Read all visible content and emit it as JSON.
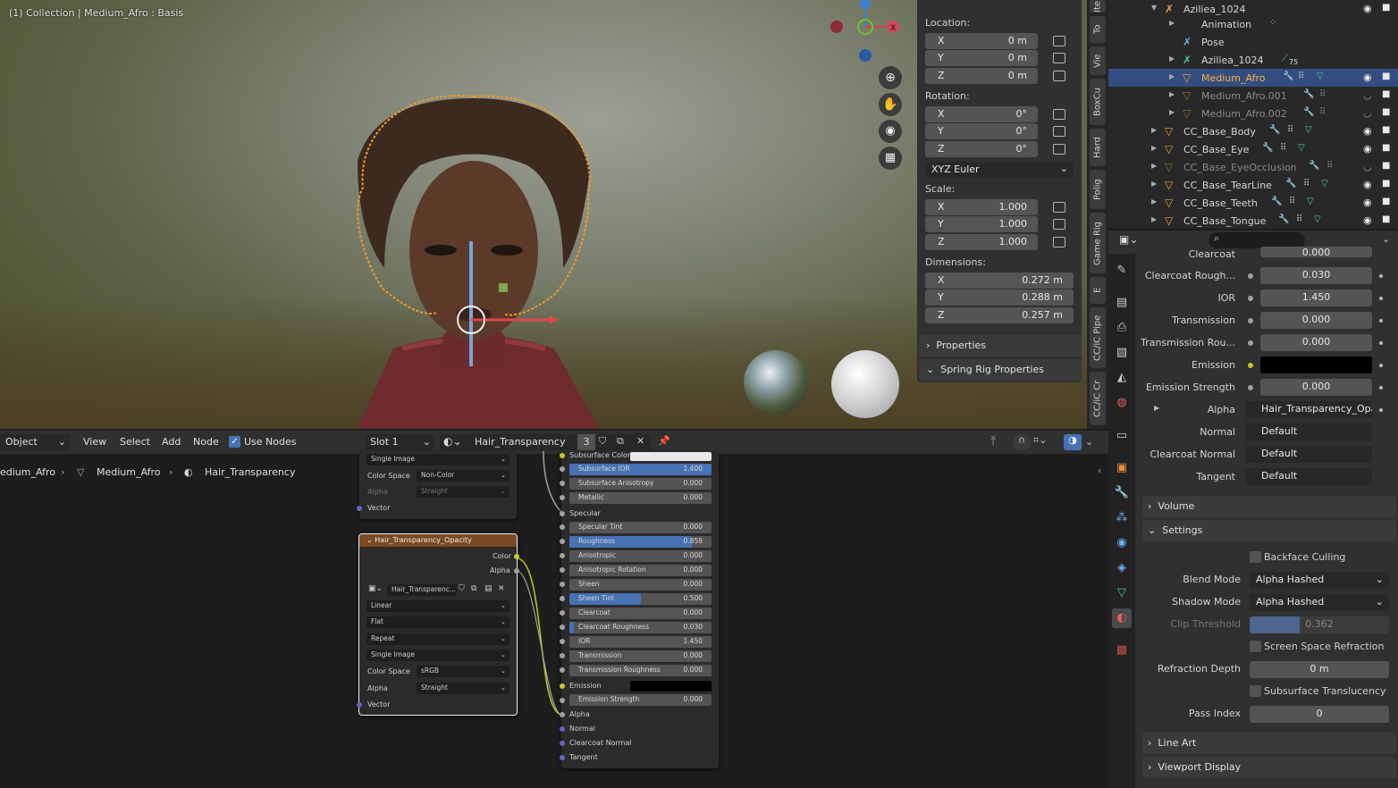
{
  "viewport": {
    "header_line2": "(1) Collection | Medium_Afro : Basis"
  },
  "npanel": {
    "location_label": "Location:",
    "location": [
      {
        "axis": "X",
        "value": "0 m"
      },
      {
        "axis": "Y",
        "value": "0 m"
      },
      {
        "axis": "Z",
        "value": "0 m"
      }
    ],
    "rotation_label": "Rotation:",
    "rotation": [
      {
        "axis": "X",
        "value": "0°"
      },
      {
        "axis": "Y",
        "value": "0°"
      },
      {
        "axis": "Z",
        "value": "0°"
      }
    ],
    "rotation_mode": "XYZ Euler",
    "scale_label": "Scale:",
    "scale": [
      {
        "axis": "X",
        "value": "1.000"
      },
      {
        "axis": "Y",
        "value": "1.000"
      },
      {
        "axis": "Z",
        "value": "1.000"
      }
    ],
    "dimensions_label": "Dimensions:",
    "dimensions": [
      {
        "axis": "X",
        "value": "0.272 m"
      },
      {
        "axis": "Y",
        "value": "0.288 m"
      },
      {
        "axis": "Z",
        "value": "0.257 m"
      }
    ],
    "sections": [
      "Properties",
      "Spring Rig Properties"
    ]
  },
  "side_tabs": [
    "Ite",
    "To",
    "Vie",
    "BoxCu",
    "Hard",
    "Polig",
    "Game Rig",
    "E",
    "CC/iC Pipe",
    "CC/iC Cr"
  ],
  "outliner": {
    "rows": [
      {
        "label": "Aziliea_1024",
        "icon": "armature-icon"
      },
      {
        "label": "Animation",
        "icon": "action-icon"
      },
      {
        "label": "Pose",
        "icon": "pose-icon"
      },
      {
        "label": "Aziliea_1024",
        "icon": "armature-data-icon",
        "badge": "75"
      },
      {
        "label": "Medium_Afro",
        "icon": "mesh-icon",
        "selected": true
      },
      {
        "label": "Medium_Afro.001",
        "icon": "mesh-icon"
      },
      {
        "label": "Medium_Afro.002",
        "icon": "mesh-icon"
      },
      {
        "label": "CC_Base_Body",
        "icon": "mesh-icon"
      },
      {
        "label": "CC_Base_Eye",
        "icon": "mesh-icon"
      },
      {
        "label": "CC_Base_EyeOcclusion",
        "icon": "mesh-icon"
      },
      {
        "label": "CC_Base_TearLine",
        "icon": "mesh-icon"
      },
      {
        "label": "CC_Base_Teeth",
        "icon": "mesh-icon"
      },
      {
        "label": "CC_Base_Tongue",
        "icon": "mesh-icon"
      }
    ]
  },
  "properties": {
    "search_placeholder": "",
    "clearcoat_label": "Clearcoat",
    "clearcoat_value": "0.000",
    "fields": [
      {
        "label": "Clearcoat Rough...",
        "value": "0.030"
      },
      {
        "label": "IOR",
        "value": "1.450"
      },
      {
        "label": "Transmission",
        "value": "0.000"
      },
      {
        "label": "Transmission Rou...",
        "value": "0.000"
      },
      {
        "label": "Emission",
        "value": ""
      },
      {
        "label": "Emission Strength",
        "value": "0.000"
      }
    ],
    "alpha_label": "Alpha",
    "alpha_link": "Hair_Transparency_Opa...",
    "links": [
      {
        "label": "Normal",
        "value": "Default"
      },
      {
        "label": "Clearcoat Normal",
        "value": "Default"
      },
      {
        "label": "Tangent",
        "value": "Default"
      }
    ],
    "volume_section": "Volume",
    "settings_section": "Settings",
    "backface_culling": "Backface Culling",
    "blend_mode_label": "Blend Mode",
    "blend_mode": "Alpha Hashed",
    "shadow_mode_label": "Shadow Mode",
    "shadow_mode": "Alpha Hashed",
    "clip_threshold_label": "Clip Threshold",
    "clip_threshold": "0.362",
    "ssr": "Screen Space Refraction",
    "refraction_depth_label": "Refraction Depth",
    "refraction_depth": "0 m",
    "subsurface_translucency": "Subsurface Translucency",
    "pass_index_label": "Pass Index",
    "pass_index": "0",
    "line_art_section": "Line Art",
    "viewport_display_section": "Viewport Display"
  },
  "node_header": {
    "mode": "Object",
    "menus": [
      "View",
      "Select",
      "Add",
      "Node"
    ],
    "use_nodes": "Use Nodes",
    "slot": "Slot 1",
    "material": "Hair_Transparency",
    "users": "3"
  },
  "breadcrumb": [
    "edium_Afro",
    "Medium_Afro",
    "Hair_Transparency"
  ],
  "node_top": {
    "rows": [
      {
        "label": "Single Image",
        "value": ""
      },
      {
        "label": "Color Space",
        "value": "Non-Color"
      },
      {
        "label": "Alpha",
        "value": "Straight"
      }
    ],
    "vector": "Vector"
  },
  "node_image": {
    "title": "Hair_Transparency_Opacity",
    "out_color": "Color",
    "out_alpha": "Alpha",
    "image_name": "Hair_Transparenc...",
    "interp": "Linear",
    "proj": "Flat",
    "ext": "Repeat",
    "source": "Single Image",
    "cs_label": "Color Space",
    "cs": "sRGB",
    "alpha_label": "Alpha",
    "alpha": "Straight",
    "vector": "Vector"
  },
  "bsdf": {
    "subsurface_color": "Subsurface Color",
    "bars": [
      {
        "name": "Subsurface IOR",
        "value": "1.400",
        "fill": 1.0
      },
      {
        "name": "Subsurface Anisotropy",
        "value": "0.000",
        "fill": 0
      },
      {
        "name": "Metallic",
        "value": "0.000",
        "fill": 0
      }
    ],
    "specular": "Specular",
    "bars2": [
      {
        "name": "Specular Tint",
        "value": "0.000",
        "fill": 0
      },
      {
        "name": "Roughness",
        "value": "0.859",
        "fill": 0.859
      },
      {
        "name": "Anisotropic",
        "value": "0.000",
        "fill": 0
      },
      {
        "name": "Anisotropic Rotation",
        "value": "0.000",
        "fill": 0
      },
      {
        "name": "Sheen",
        "value": "0.000",
        "fill": 0
      },
      {
        "name": "Sheen Tint",
        "value": "0.500",
        "fill": 0.5
      },
      {
        "name": "Clearcoat",
        "value": "0.000",
        "fill": 0
      },
      {
        "name": "Clearcoat Roughness",
        "value": "0.030",
        "fill": 0.03
      },
      {
        "name": "IOR",
        "value": "1.450",
        "fill": 0
      },
      {
        "name": "Transmission",
        "value": "0.000",
        "fill": 0
      },
      {
        "name": "Transmission Roughness",
        "value": "0.000",
        "fill": 0
      }
    ],
    "emission": "Emission",
    "emission_strength": "Emission Strength",
    "emission_strength_value": "0.000",
    "inputs": [
      "Alpha",
      "Normal",
      "Clearcoat Normal",
      "Tangent"
    ]
  }
}
